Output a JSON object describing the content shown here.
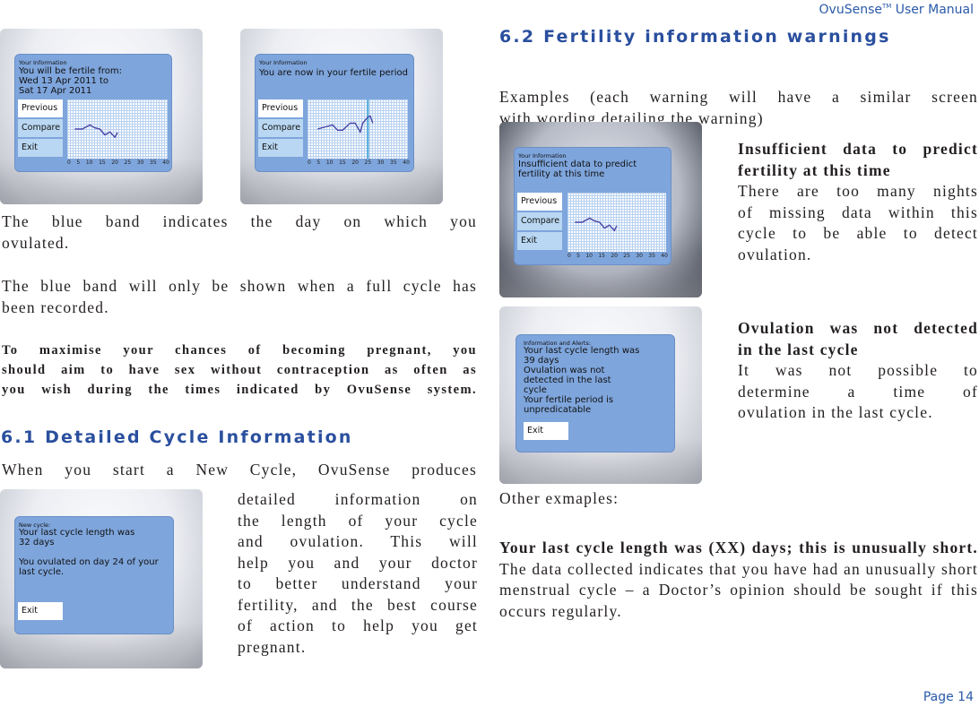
{
  "header": {
    "brand": "OvuSense",
    "tm": "TM",
    "title": "User Manual"
  },
  "footer": {
    "page": "Page 14"
  },
  "left": {
    "screens_top": [
      {
        "small": "Your Information",
        "message": "You will be fertile from:\nWed  13 Apr 2011 to\nSat   17 Apr 2011",
        "buttons": [
          "Previous",
          "Compare",
          "Exit"
        ],
        "ticks": [
          "0",
          "5",
          "10",
          "15",
          "20",
          "25",
          "30",
          "35",
          "40"
        ]
      },
      {
        "small": "Your Information",
        "message": "You are now in your fertile period",
        "buttons": [
          "Previous",
          "Compare",
          "Exit"
        ],
        "ticks": [
          "0",
          "5",
          "10",
          "15",
          "20",
          "25",
          "30",
          "35",
          "40"
        ],
        "ovulation_band_day": 24
      }
    ],
    "para1": [
      "The blue band indicates the day on which you",
      "ovulated."
    ],
    "para2": [
      "The blue band will only be shown when a full cycle has",
      "been recorded."
    ],
    "para3": [
      "To maximise your chances of becoming pregnant, you",
      "should aim to have sex without contraception as often as",
      "you wish during the times indicated by OvuSense system."
    ],
    "heading_61": "6.1 Detailed Cycle Information",
    "para4_first": "When you start a New Cycle, OvuSense produces",
    "para4_rest": [
      "detailed information on",
      "the length of your cycle",
      "and ovulation. This will",
      "help you and your doctor",
      "to better understand your",
      "fertility, and the best course",
      "of action to help you get",
      "pregnant."
    ],
    "screen_new_cycle": {
      "small": "New cycle:",
      "message": "Your last cycle length was\n32 days\n\nYou ovulated on day 24 of your\nlast cycle.",
      "buttons": [
        "Exit"
      ]
    }
  },
  "right": {
    "heading_62": "6.2 Fertility information warnings",
    "intro": [
      "Examples (each warning will have a similar screen",
      "with wording detailing the warning)"
    ],
    "warning1": {
      "title": [
        "Insufficient data to predict",
        "fertility at this time"
      ],
      "body": [
        "There are too many nights",
        "of missing data within this",
        "cycle to be able to detect",
        "ovulation."
      ],
      "screen": {
        "small": "Your Information",
        "message": "Insufficient data to predict\nfertility at this time",
        "buttons": [
          "Previous",
          "Compare",
          "Exit"
        ],
        "ticks": [
          "0",
          "5",
          "10",
          "15",
          "20",
          "25",
          "30",
          "35",
          "40"
        ]
      }
    },
    "warning2": {
      "title": [
        "Ovulation was not detected",
        "in the last cycle"
      ],
      "body": [
        "It was not possible to",
        "determine a time of",
        "ovulation in the last cycle."
      ],
      "screen": {
        "small": "Information and Alerts:",
        "message": "Your last cycle length was\n39 days\nOvulation was not\ndetected in the last\ncycle\nYour fertile period is\nunpredicatable",
        "buttons": [
          "Exit"
        ]
      }
    },
    "other_label": "Other exmaples:",
    "other": {
      "bold": "Your last cycle length was (XX) days; this is unusually short.",
      "rest": " The data collected indicates that you have had an unusually short menstrual cycle – a Doctor’s opinion should be sought if this occurs regularly."
    }
  },
  "chart_curves": {
    "short": {
      "days": [
        3,
        6,
        9,
        11,
        13,
        15,
        17,
        19,
        20
      ],
      "values": [
        0.5,
        0.5,
        0.57,
        0.52,
        0.5,
        0.4,
        0.45,
        0.36,
        0.44
      ]
    },
    "full": {
      "days": [
        4,
        10,
        12,
        14,
        17,
        19,
        21,
        22,
        24,
        25,
        26
      ],
      "values": [
        0.5,
        0.57,
        0.48,
        0.48,
        0.6,
        0.6,
        0.45,
        0.6,
        0.7,
        0.72,
        0.6
      ]
    }
  },
  "colors": {
    "accent": "#2a4f9e",
    "screen": "#7ea5dc",
    "curve": "#4a44a8",
    "band": "#5fb0dc"
  }
}
